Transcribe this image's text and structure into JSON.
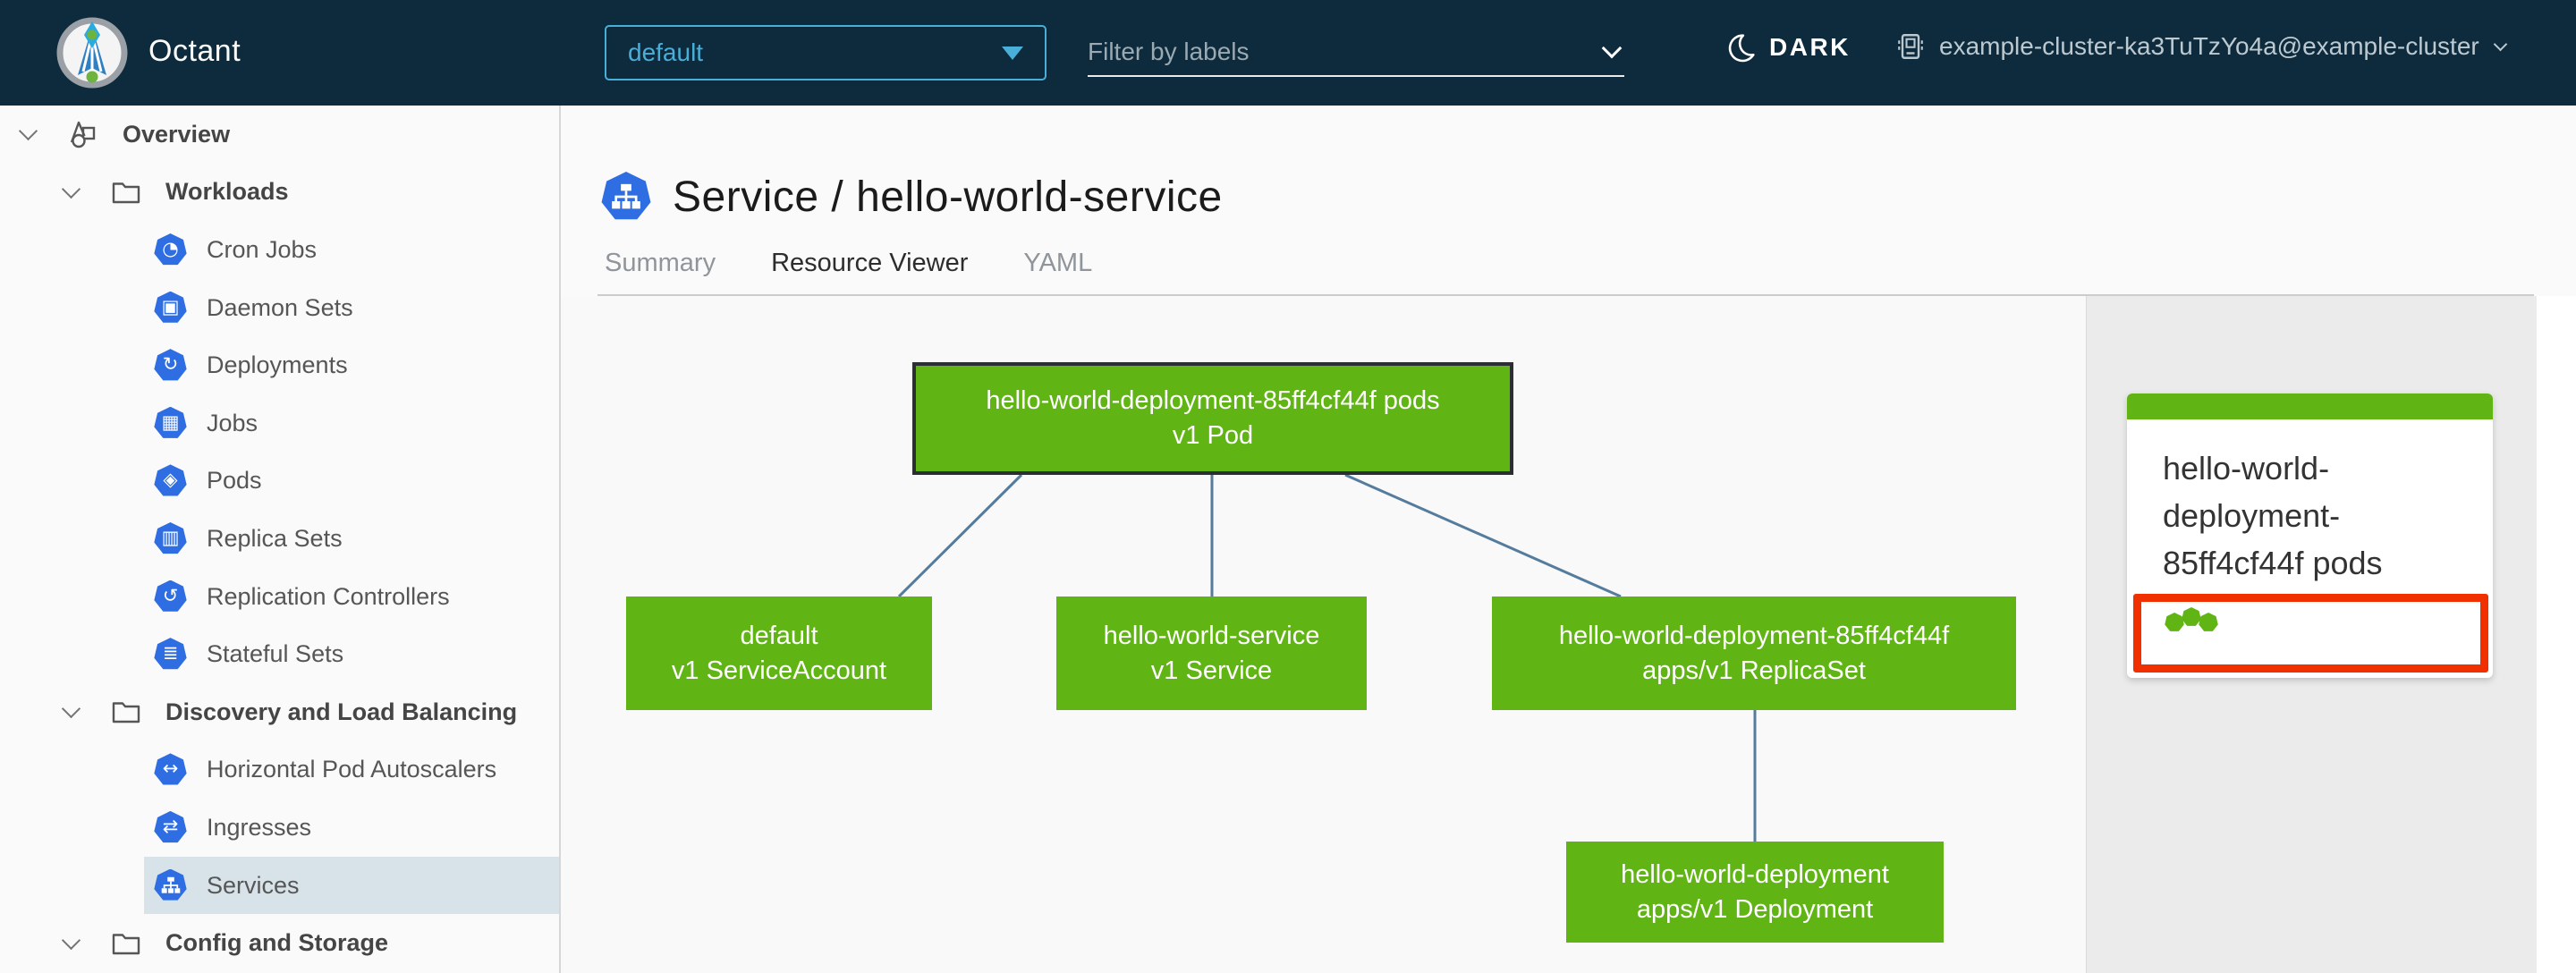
{
  "header": {
    "app_title": "Octant",
    "namespace_select": {
      "value": "default"
    },
    "filter": {
      "placeholder": "Filter by labels"
    },
    "theme_toggle": {
      "label": "DARK"
    },
    "cluster_select": {
      "label": "example-cluster-ka3TuTzYo4a@example-cluster"
    }
  },
  "sidebar": {
    "items": [
      {
        "label": "Overview",
        "icon": "objects-icon",
        "level": 0
      },
      {
        "label": "Workloads",
        "icon": "folder-icon",
        "level": 1
      },
      {
        "label": "Cron Jobs",
        "icon": "cronjobs-icon",
        "glyph": "◔",
        "level": 2
      },
      {
        "label": "Daemon Sets",
        "icon": "daemonsets-icon",
        "glyph": "▣",
        "level": 2
      },
      {
        "label": "Deployments",
        "icon": "deployments-icon",
        "glyph": "↻",
        "level": 2
      },
      {
        "label": "Jobs",
        "icon": "jobs-icon",
        "glyph": "▦",
        "level": 2
      },
      {
        "label": "Pods",
        "icon": "pods-icon",
        "glyph": "◈",
        "level": 2
      },
      {
        "label": "Replica Sets",
        "icon": "replicasets-icon",
        "glyph": "▥",
        "level": 2
      },
      {
        "label": "Replication Controllers",
        "icon": "replicationcontrollers-icon",
        "glyph": "↺",
        "level": 2
      },
      {
        "label": "Stateful Sets",
        "icon": "statefulsets-icon",
        "glyph": "≣",
        "level": 2
      },
      {
        "label": "Discovery and Load Balancing",
        "icon": "folder-icon",
        "level": 1
      },
      {
        "label": "Horizontal Pod Autoscalers",
        "icon": "hpa-icon",
        "glyph": "↔",
        "level": 2
      },
      {
        "label": "Ingresses",
        "icon": "ingresses-icon",
        "glyph": "⇄",
        "level": 2
      },
      {
        "label": "Services",
        "icon": "services-icon",
        "level": 2,
        "selected": true
      },
      {
        "label": "Config and Storage",
        "icon": "folder-icon",
        "level": 1
      }
    ]
  },
  "main": {
    "title": "Service / hello-world-service",
    "tabs": [
      {
        "label": "Summary",
        "active": false
      },
      {
        "label": "Resource Viewer",
        "active": true
      },
      {
        "label": "YAML",
        "active": false
      }
    ]
  },
  "graph": {
    "nodes": [
      {
        "name": "hello-world-deployment-85ff4cf44f pods",
        "kind": "v1 Pod",
        "selected": true
      },
      {
        "name": "default",
        "kind": "v1 ServiceAccount"
      },
      {
        "name": "hello-world-service",
        "kind": "v1 Service"
      },
      {
        "name": "hello-world-deployment-85ff4cf44f",
        "kind": "apps/v1 ReplicaSet"
      },
      {
        "name": "hello-world-deployment",
        "kind": "apps/v1 Deployment"
      }
    ],
    "edges": [
      {
        "from": "pod",
        "to": "serviceaccount"
      },
      {
        "from": "pod",
        "to": "service"
      },
      {
        "from": "pod",
        "to": "replicaset"
      },
      {
        "from": "replicaset",
        "to": "deployment"
      }
    ]
  },
  "detail_panel": {
    "card": {
      "title": "hello-world-deployment-85ff4cf44f pods",
      "status_dots": 3
    }
  },
  "colors": {
    "header_bg": "#0d2b3c",
    "accent_blue": "#49afd9",
    "k8s_icon_blue": "#2e6de2",
    "tab_active_blue": "#0b72a8",
    "node_green": "#60b515",
    "alert_red": "#f13000",
    "edge_blue": "#557b9d",
    "sidebar_selected_bg": "#d8e3e9"
  }
}
